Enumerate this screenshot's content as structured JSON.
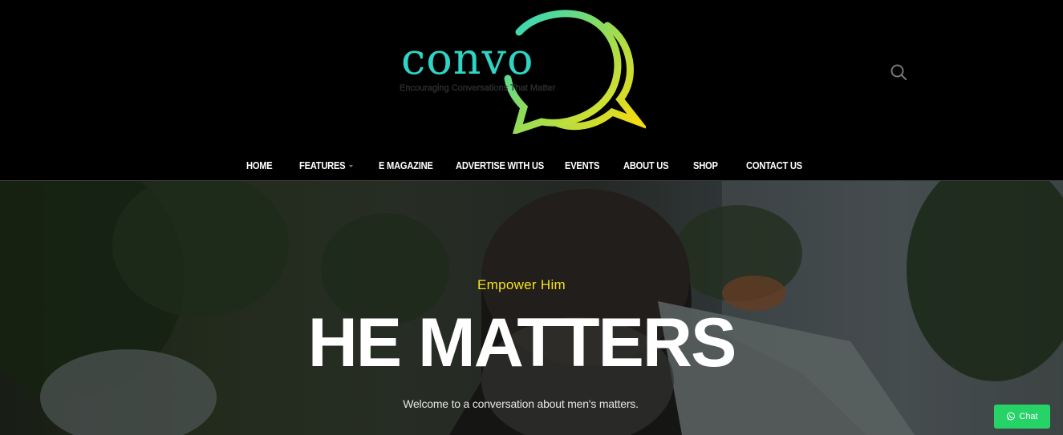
{
  "brand": {
    "logo_word": "convo",
    "tagline": "Encouraging Conversations That Matter"
  },
  "nav": {
    "items": [
      {
        "label": "HOME"
      },
      {
        "label": "FEATURES",
        "has_dropdown": true
      },
      {
        "label": "E MAGAZINE"
      },
      {
        "label": "ADVERTISE WITH US"
      },
      {
        "label": "EVENTS"
      },
      {
        "label": "ABOUT US"
      },
      {
        "label": "SHOP"
      },
      {
        "label": "CONTACT US"
      }
    ]
  },
  "hero": {
    "eyebrow": "Empower Him",
    "headline": "HE MATTERS",
    "subtext": "Welcome to a conversation about men's matters."
  },
  "chat": {
    "label": "Chat"
  },
  "icons": {
    "search": "search-icon",
    "chat": "whatsapp-icon",
    "dropdown": "chevron-down-icon"
  },
  "colors": {
    "header_bg": "#000000",
    "accent_yellow": "#f4e21a",
    "logo_teal": "#2fd4c4",
    "chat_green": "#25d366"
  }
}
